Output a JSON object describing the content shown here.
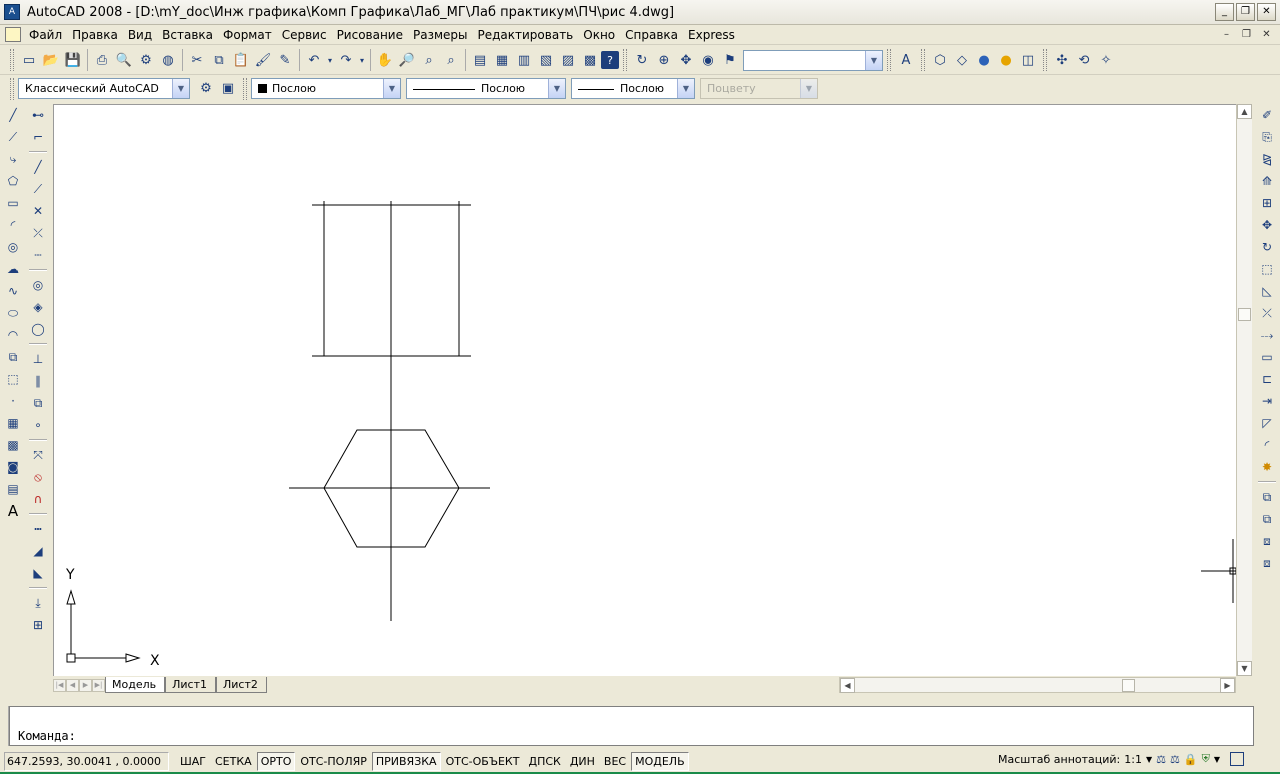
{
  "window": {
    "title": "AutoCAD 2008 - [D:\\mY_doc\\Инж графика\\Комп Графика\\Лаб_МГ\\Лаб практикум\\ПЧ\\рис 4.dwg]",
    "logo_text": "A",
    "minimize": "_",
    "restore": "❐",
    "close": "✕"
  },
  "menu": {
    "items": [
      "Файл",
      "Правка",
      "Вид",
      "Вставка",
      "Формат",
      "Сервис",
      "Рисование",
      "Размеры",
      "Редактировать",
      "Окно",
      "Справка",
      "Express"
    ]
  },
  "toolbar_icons": [
    "new-file-icon",
    "open-file-icon",
    "save-icon",
    "plot-icon",
    "plot-preview-icon",
    "publish-icon",
    "publish-3d-icon",
    "cut-icon",
    "copy-icon",
    "paste-icon",
    "match-properties-icon",
    "block-editor-icon",
    "undo-icon",
    "redo-icon",
    "pan-icon",
    "zoom-realtime-icon",
    "zoom-window-icon",
    "zoom-previous-icon",
    "properties-icon",
    "design-center-icon",
    "tool-palettes-icon",
    "sheet-set-icon",
    "markup-icon",
    "quickcalc-icon",
    "help-icon"
  ],
  "styles": {
    "workspace": "Классический AutoCAD",
    "layer": "Послою",
    "linetype": "Послою",
    "lineweight": "Послою",
    "plotstyle": "Поцвету",
    "named_view": ""
  },
  "tabs": [
    "Модель",
    "Лист1",
    "Лист2"
  ],
  "command": {
    "prompt": "Команда:"
  },
  "status": {
    "coords": "647.2593, 30.0041 , 0.0000",
    "buttons": [
      "ШАГ",
      "СЕТКА",
      "ОРТО",
      "ОТС-ПОЛЯР",
      "ПРИВЯЗКА",
      "ОТС-ОБЪЕКТ",
      "ДПСК",
      "ДИН",
      "ВЕС",
      "МОДЕЛЬ"
    ],
    "active": [
      "ОРТО",
      "ПРИВЯЗКА",
      "МОДЕЛЬ"
    ],
    "annotation_scale_label": "Масштаб аннотаций:",
    "annotation_scale": "1:1"
  },
  "ucs": {
    "x_label": "X",
    "y_label": "Y"
  },
  "colors": {
    "canvas": "#ffffff",
    "chrome": "#ece9d8",
    "icon_accent": "#1d3e7c",
    "taskbar": "#1a8b4a"
  }
}
